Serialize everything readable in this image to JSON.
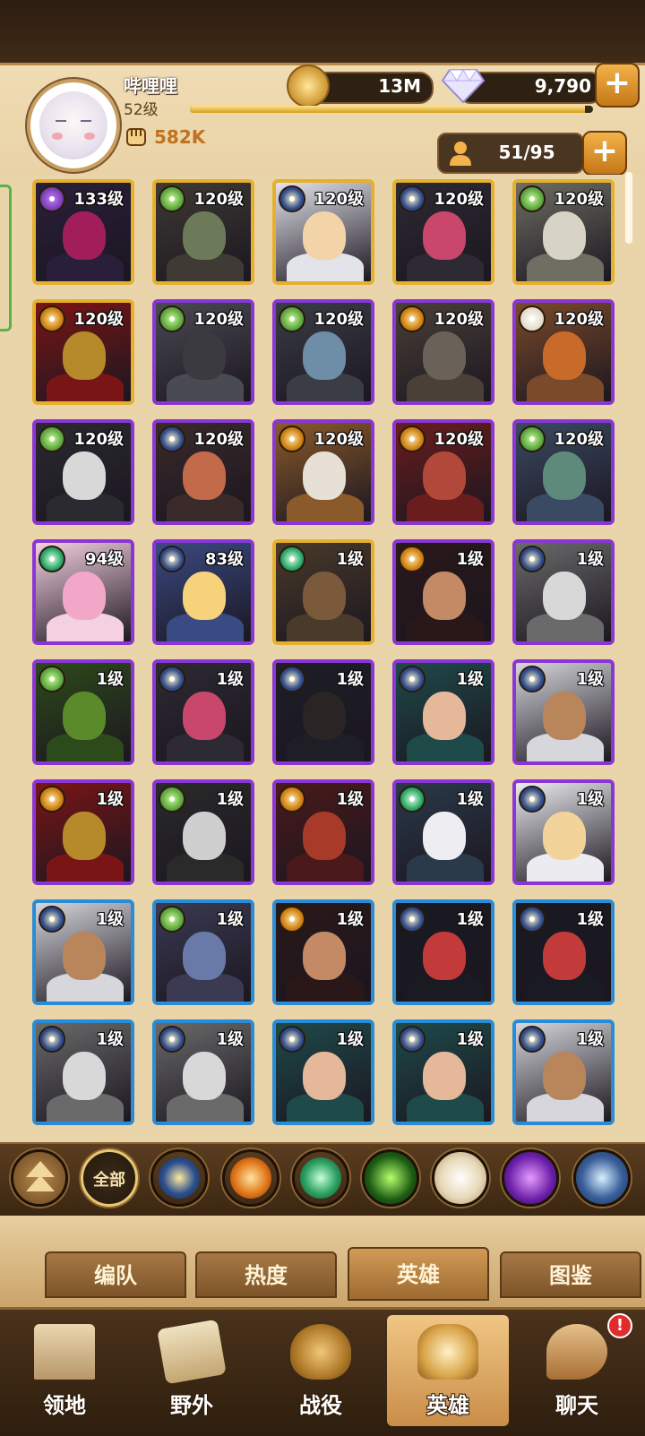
{
  "player": {
    "name": "哔哩哩",
    "level": "52级",
    "power": "582K"
  },
  "currency": {
    "gold": "13M",
    "diamonds": "9,790",
    "add_symbol": "+"
  },
  "xp_progress": 0.98,
  "hero_count": "51/95",
  "heroes": [
    {
      "level": "133级",
      "frame": "gold",
      "faction": "graveborn",
      "head": "#a11e5a",
      "body": "#2a1f3a"
    },
    {
      "level": "120级",
      "frame": "gold",
      "faction": "wilder",
      "head": "#6c7a5a",
      "body": "#3f3a34"
    },
    {
      "level": "120级",
      "frame": "gold",
      "faction": "light",
      "head": "#f2d4a8",
      "body": "#e3e3ea"
    },
    {
      "level": "120级",
      "frame": "gold",
      "faction": "light",
      "head": "#c9466d",
      "body": "#2d2a33"
    },
    {
      "level": "120级",
      "frame": "gold",
      "faction": "wilder",
      "head": "#d8d4c5",
      "body": "#6e6e62"
    },
    {
      "level": "120级",
      "frame": "gold",
      "faction": "mauler",
      "head": "#b68a2a",
      "body": "#7a1515"
    },
    {
      "level": "120级",
      "frame": "purple",
      "faction": "wilder",
      "head": "#3a3a40",
      "body": "#4a4a52"
    },
    {
      "level": "120级",
      "frame": "purple",
      "faction": "wilder",
      "head": "#6e8ea8",
      "body": "#3a3d45"
    },
    {
      "level": "120级",
      "frame": "purple",
      "faction": "mauler",
      "head": "#6a6258",
      "body": "#4a4038"
    },
    {
      "level": "120级",
      "frame": "purple",
      "faction": "celestial",
      "head": "#c86b2a",
      "body": "#7a4a2a"
    },
    {
      "level": "120级",
      "frame": "purple",
      "faction": "wilder",
      "head": "#d8d8d8",
      "body": "#2a2a30"
    },
    {
      "level": "120级",
      "frame": "purple",
      "faction": "light",
      "head": "#c26a4a",
      "body": "#3a2a2a"
    },
    {
      "level": "120级",
      "frame": "purple",
      "faction": "mauler",
      "head": "#e6e0d6",
      "body": "#8a5a2a"
    },
    {
      "level": "120级",
      "frame": "purple",
      "faction": "mauler",
      "head": "#b2483a",
      "body": "#6a1d1d"
    },
    {
      "level": "120级",
      "frame": "purple",
      "faction": "wilder",
      "head": "#5d8a7a",
      "body": "#3a4a62"
    },
    {
      "level": "94级",
      "frame": "purple",
      "faction": "wilder2",
      "head": "#f2a6c8",
      "body": "#f4d0e0"
    },
    {
      "level": "83级",
      "frame": "purple",
      "faction": "light",
      "head": "#f6d27a",
      "body": "#3a4a82"
    },
    {
      "level": "1级",
      "frame": "gold",
      "faction": "wilder2",
      "head": "#7a5a3a",
      "body": "#4a3a2a"
    },
    {
      "level": "1级",
      "frame": "purple",
      "faction": "mauler",
      "head": "#c48a66",
      "body": "#2a1818"
    },
    {
      "level": "1级",
      "frame": "purple",
      "faction": "light",
      "head": "#d8d8d8",
      "body": "#6a6a6a"
    },
    {
      "level": "1级",
      "frame": "purple",
      "faction": "wilder",
      "head": "#5a8a2a",
      "body": "#2d4a1a"
    },
    {
      "level": "1级",
      "frame": "purple",
      "faction": "light",
      "head": "#c9466d",
      "body": "#2d2a33"
    },
    {
      "level": "1级",
      "frame": "purple",
      "faction": "light",
      "head": "#2a2424",
      "body": "#1e1e26"
    },
    {
      "level": "1级",
      "frame": "purple",
      "faction": "light",
      "head": "#e6b89a",
      "body": "#1e4a4a"
    },
    {
      "level": "1级",
      "frame": "purple",
      "faction": "light",
      "head": "#b8865a",
      "body": "#d6d6dc"
    },
    {
      "level": "1级",
      "frame": "purple",
      "faction": "mauler",
      "head": "#b68a2a",
      "body": "#7a1515"
    },
    {
      "level": "1级",
      "frame": "purple",
      "faction": "wilder",
      "head": "#cfcfcf",
      "body": "#2a2a2a"
    },
    {
      "level": "1级",
      "frame": "purple",
      "faction": "mauler",
      "head": "#a83a2a",
      "body": "#4a1a1a"
    },
    {
      "level": "1级",
      "frame": "purple",
      "faction": "wilder2",
      "head": "#eeeef2",
      "body": "#2a3a4a"
    },
    {
      "level": "1级",
      "frame": "purple",
      "faction": "light",
      "head": "#f2d49a",
      "body": "#ececf0"
    },
    {
      "level": "1级",
      "frame": "blue",
      "faction": "light",
      "head": "#b8865a",
      "body": "#d6d6dc"
    },
    {
      "level": "1级",
      "frame": "blue",
      "faction": "wilder",
      "head": "#6a7aa8",
      "body": "#3a3a52"
    },
    {
      "level": "1级",
      "frame": "blue",
      "faction": "mauler",
      "head": "#c48a66",
      "body": "#2a1818"
    },
    {
      "level": "1级",
      "frame": "blue",
      "faction": "light",
      "head": "#c23a3a",
      "body": "#1a1a22"
    },
    {
      "level": "1级",
      "frame": "blue",
      "faction": "light",
      "head": "#c23a3a",
      "body": "#1a1a22"
    },
    {
      "level": "1级",
      "frame": "blue",
      "faction": "light",
      "head": "#d8d8d8",
      "body": "#6a6a6a"
    },
    {
      "level": "1级",
      "frame": "blue",
      "faction": "light",
      "head": "#d8d8d8",
      "body": "#6a6a6a"
    },
    {
      "level": "1级",
      "frame": "blue",
      "faction": "light",
      "head": "#e6b89a",
      "body": "#1e4a4a"
    },
    {
      "level": "1级",
      "frame": "blue",
      "faction": "light",
      "head": "#e6b89a",
      "body": "#1e4a4a"
    },
    {
      "level": "1级",
      "frame": "blue",
      "faction": "light",
      "head": "#b8865a",
      "body": "#d6d6dc"
    }
  ],
  "filters": {
    "all_label": "全部",
    "icons": [
      "collapse-arrows-icon",
      "all-filter",
      "lightbearer-icon",
      "mauler-icon",
      "wilder-icon",
      "graveborn-icon",
      "celestial-icon",
      "hypogean-icon",
      "dimensional-icon"
    ]
  },
  "subtabs": [
    {
      "label": "编队"
    },
    {
      "label": "热度"
    },
    {
      "label": "英雄"
    },
    {
      "label": "图鉴"
    }
  ],
  "nav": [
    {
      "label": "领地",
      "icon": "castle-icon"
    },
    {
      "label": "野外",
      "icon": "map-scroll-icon"
    },
    {
      "label": "战役",
      "icon": "battle-crest-icon"
    },
    {
      "label": "英雄",
      "icon": "hero-helmet-icon"
    },
    {
      "label": "聊天",
      "icon": "chat-bubble-icon"
    }
  ],
  "chat_badge": "!",
  "colors": {
    "gold_frame": "#e6b02c",
    "purple_frame": "#8a36d6",
    "blue_frame": "#2a8bd6",
    "power_text": "#c0721e"
  }
}
